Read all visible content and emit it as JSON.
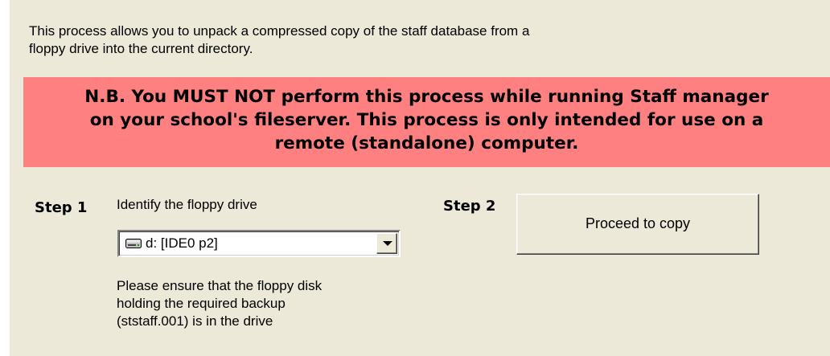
{
  "intro_lines": [
    "This process allows you to unpack a compressed copy of the staff database from a",
    "floppy drive into the current directory."
  ],
  "warning": {
    "lines": [
      "N.B. You MUST NOT perform this process while running Staff manager",
      "on your school's fileserver. This process is only intended for use on a",
      "remote (standalone) computer."
    ],
    "background_color": "#ff8080"
  },
  "step1": {
    "label": "Step 1",
    "instruction": "Identify the floppy drive",
    "drive_select": {
      "icon": "drive-icon",
      "value": "d: [IDE0 p2]"
    },
    "note_lines": [
      "Please ensure that the floppy disk",
      "holding the required backup",
      "(ststaff.001) is in the drive"
    ]
  },
  "step2": {
    "label": "Step 2",
    "button_label": "Proceed to copy"
  },
  "colors": {
    "panel_background": "#ece9d8"
  }
}
